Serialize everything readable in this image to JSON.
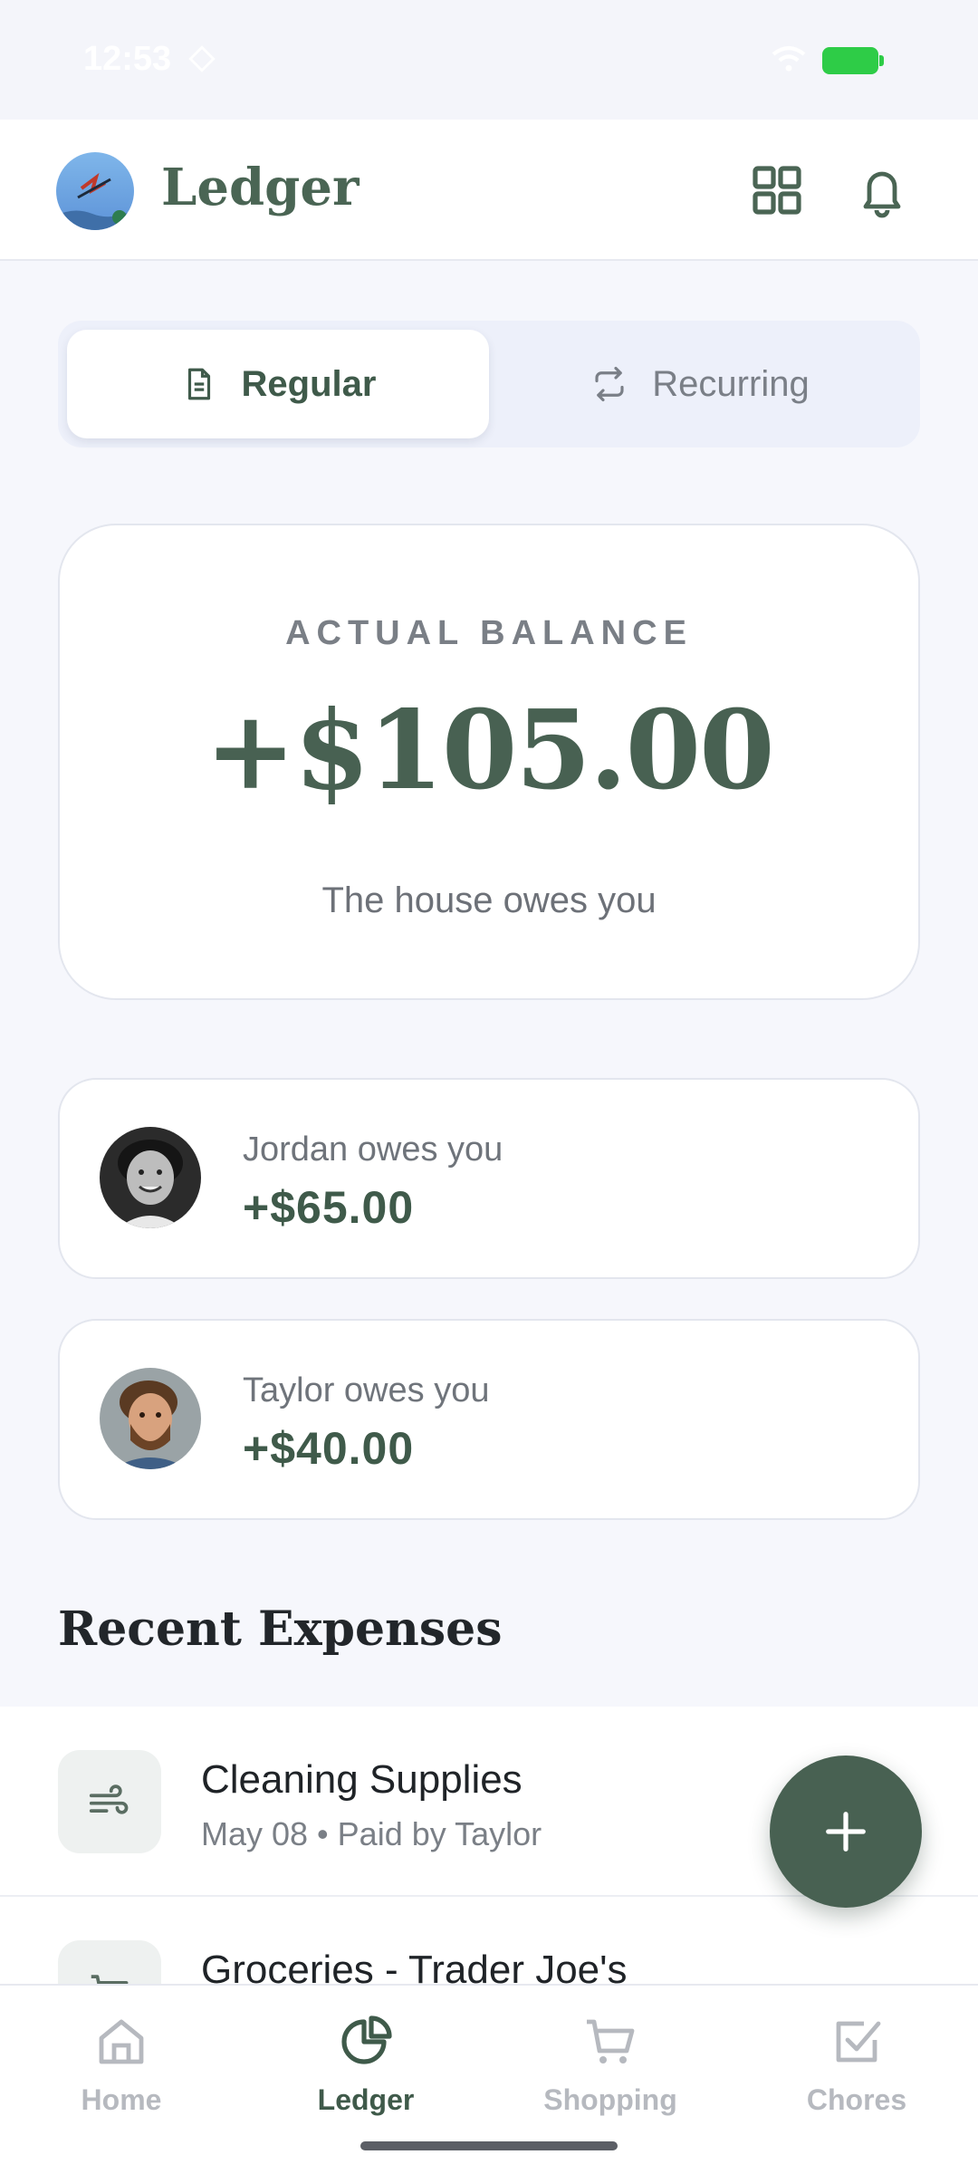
{
  "status_bar": {
    "time": "12:53"
  },
  "header": {
    "title": "Ledger",
    "icons": [
      "grid-icon",
      "bell-icon"
    ]
  },
  "toggle": {
    "regular_label": "Regular",
    "recurring_label": "Recurring",
    "active": "Regular"
  },
  "balance": {
    "label": "ACTUAL BALANCE",
    "amount": "+$105.00",
    "note": "The house owes you"
  },
  "owes": [
    {
      "label": "Jordan owes you",
      "amount": "+$65.00"
    },
    {
      "label": "Taylor owes you",
      "amount": "+$40.00"
    }
  ],
  "recent": {
    "title": "Recent Expenses",
    "items": [
      {
        "title": "Cleaning Supplies",
        "meta": "May 08 • Paid by Taylor",
        "icon": "wind-icon"
      },
      {
        "title": "Groceries - Trader Joe's",
        "meta": "",
        "icon": "cart-icon"
      }
    ]
  },
  "nav": {
    "items": [
      {
        "label": "Home",
        "icon": "home-icon"
      },
      {
        "label": "Ledger",
        "icon": "pie-chart-icon"
      },
      {
        "label": "Shopping",
        "icon": "cart-icon"
      },
      {
        "label": "Chores",
        "icon": "checkbox-icon"
      }
    ],
    "active": "Ledger"
  },
  "colors": {
    "accent": "#486152",
    "background": "#f6f7fc",
    "battery": "#2ecc47"
  }
}
